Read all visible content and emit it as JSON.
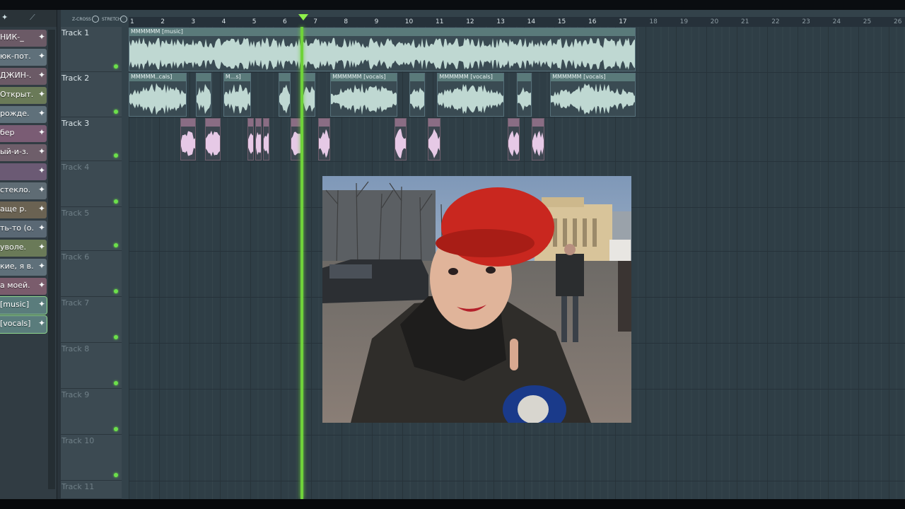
{
  "browser": {
    "items": [
      {
        "label": "НИК-_",
        "color": "#6b5a66"
      },
      {
        "label": "юк-пот.",
        "color": "#5f707a"
      },
      {
        "label": "ДЖИН-.",
        "color": "#6b5a66"
      },
      {
        "label": "Открыт.",
        "color": "#6a7a58"
      },
      {
        "label": "рожде.",
        "color": "#5f707a"
      },
      {
        "label": "бер",
        "color": "#7a5c74"
      },
      {
        "label": "ый-и-з.",
        "color": "#6e5e6a"
      },
      {
        "label": "",
        "color": "#6b5a74"
      },
      {
        "label": "стекло.",
        "color": "#5f6c74"
      },
      {
        "label": "аще р.",
        "color": "#6a6252"
      },
      {
        "label": "ть-то (о.",
        "color": "#5a6874"
      },
      {
        "label": "уволе.",
        "color": "#6a7a58"
      },
      {
        "label": "кие, я в.",
        "color": "#5f707a"
      },
      {
        "label": "а моей.",
        "color": "#7a5c6c"
      },
      {
        "label": "[music]",
        "color": "#5a7c7c"
      },
      {
        "label": "[vocals]",
        "color": "#5a7c7c"
      }
    ]
  },
  "options": {
    "zcross": "Z-CROSS",
    "stretch": "STRETCH"
  },
  "ruler": {
    "bars": [
      "1",
      "2",
      "3",
      "4",
      "5",
      "6",
      "7",
      "8",
      "9",
      "10",
      "11",
      "12",
      "13",
      "14",
      "15",
      "16",
      "17",
      "18",
      "19",
      "20",
      "21",
      "22",
      "23",
      "24",
      "25",
      "26"
    ],
    "active_until": 17
  },
  "tracks": [
    "Track 1",
    "Track 2",
    "Track 3",
    "Track 4",
    "Track 5",
    "Track 6",
    "Track 7",
    "Track 8",
    "Track 9",
    "Track 10",
    "Track 11"
  ],
  "clips": {
    "track1": [
      {
        "label": "MMMMMM [music]",
        "start": 1,
        "end": 17.6
      }
    ],
    "track2": [
      {
        "label": "MMMMM..cals]",
        "start": 1,
        "end": 2.9
      },
      {
        "label": "",
        "start": 3.2,
        "end": 3.7
      },
      {
        "label": "M...s]",
        "start": 4.1,
        "end": 5.0
      },
      {
        "label": "",
        "start": 5.9,
        "end": 6.3
      },
      {
        "label": "",
        "start": 6.7,
        "end": 7.1
      },
      {
        "label": "MMMMMM [vocals]",
        "start": 7.6,
        "end": 9.8
      },
      {
        "label": "",
        "start": 10.2,
        "end": 10.7
      },
      {
        "label": "MMMMMM [vocals]",
        "start": 11.1,
        "end": 13.3
      },
      {
        "label": "",
        "start": 13.7,
        "end": 14.2
      },
      {
        "label": "MMMMMM [vocals]",
        "start": 14.8,
        "end": 17.6
      }
    ],
    "track3": [
      {
        "label": "",
        "start": 2.7,
        "end": 3.2
      },
      {
        "label": "",
        "start": 3.5,
        "end": 4.0
      },
      {
        "label": "",
        "start": 4.9,
        "end": 5.1
      },
      {
        "label": "",
        "start": 5.15,
        "end": 5.35
      },
      {
        "label": "",
        "start": 5.4,
        "end": 5.6
      },
      {
        "label": "",
        "start": 6.3,
        "end": 6.7
      },
      {
        "label": "",
        "start": 7.2,
        "end": 7.6
      },
      {
        "label": "",
        "start": 9.7,
        "end": 10.1
      },
      {
        "label": "",
        "start": 10.8,
        "end": 11.2
      },
      {
        "label": "",
        "start": 13.4,
        "end": 13.8
      },
      {
        "label": "",
        "start": 14.2,
        "end": 14.6
      }
    ]
  },
  "playhead_bar": 6.6,
  "colors": {
    "accent_green": "#6fd23a",
    "clip_teal": "#5a7a7a",
    "clip_pink": "#8a6d84",
    "wave": "#bfd8d2",
    "wave_pink": "#e6c9e6"
  }
}
